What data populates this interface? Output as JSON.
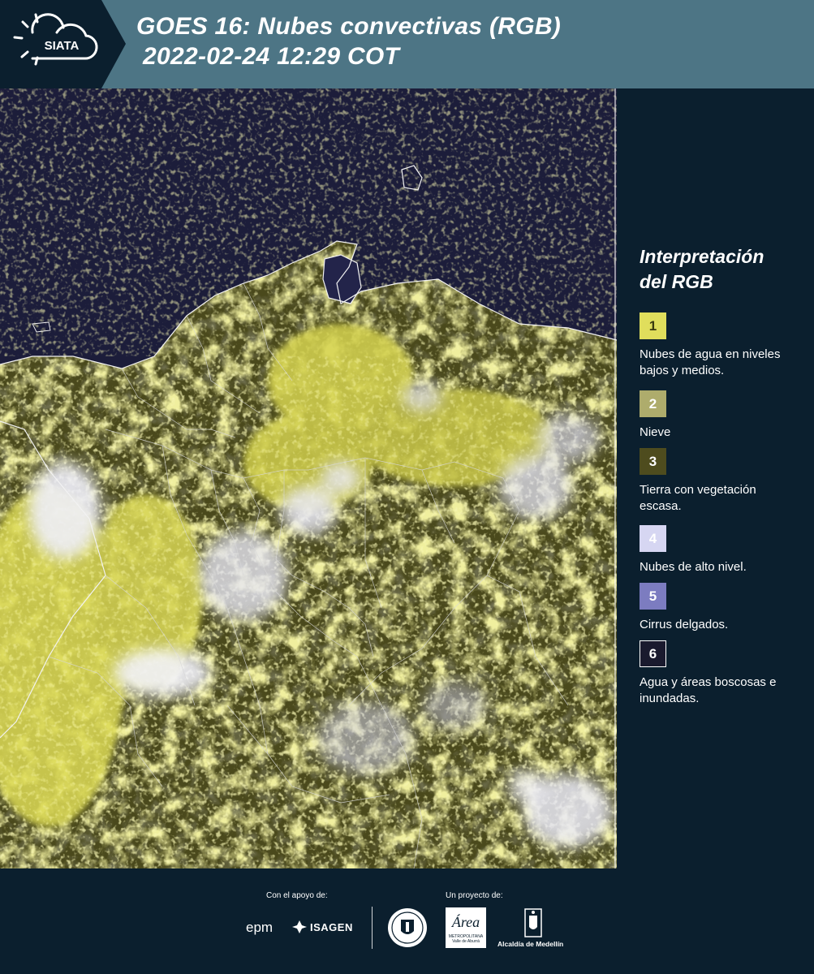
{
  "header": {
    "logo_text": "SIATA",
    "title_line1": "GOES 16: Nubes convectivas (RGB)",
    "title_line2": "2022-02-24 12:29 COT"
  },
  "legend": {
    "title_line1": "Interpretación",
    "title_line2": "del RGB",
    "items": [
      {
        "number": "1",
        "color": "#e0de5c",
        "number_color": "#3a3a10",
        "label": "Nubes de agua en niveles bajos y medios."
      },
      {
        "number": "2",
        "color": "#aeac6c",
        "number_color": "#ffffff",
        "label": "Nieve"
      },
      {
        "number": "3",
        "color": "#4e4c1e",
        "number_color": "#ffffff",
        "label": "Tierra con vegetación escasa."
      },
      {
        "number": "4",
        "color": "#d6d6f2",
        "number_color": "#ffffff",
        "label": "Nubes de alto nivel."
      },
      {
        "number": "5",
        "color": "#7c7cc0",
        "number_color": "#ffffff",
        "label": "Cirrus delgados."
      },
      {
        "number": "6",
        "color": "#1a1a2e",
        "number_color": "#ffffff",
        "label": "Agua y áreas boscosas e inundadas."
      }
    ]
  },
  "footer": {
    "support_label": "Con el apoyo de:",
    "project_label": "Un proyecto de:",
    "sponsors": [
      "epm",
      "ISAGEN"
    ],
    "partners": [
      "METROPOLITANA Valle de Aburrá",
      "Alcaldía de Medellín"
    ],
    "area_logo_text": "Área"
  },
  "colors": {
    "header_bg": "#4d7585",
    "page_bg": "#0b1f2e",
    "ocean": "#1c1d3a",
    "low_cloud_yellow": "#e0de5c",
    "high_cloud_white": "#e8e8f4"
  }
}
